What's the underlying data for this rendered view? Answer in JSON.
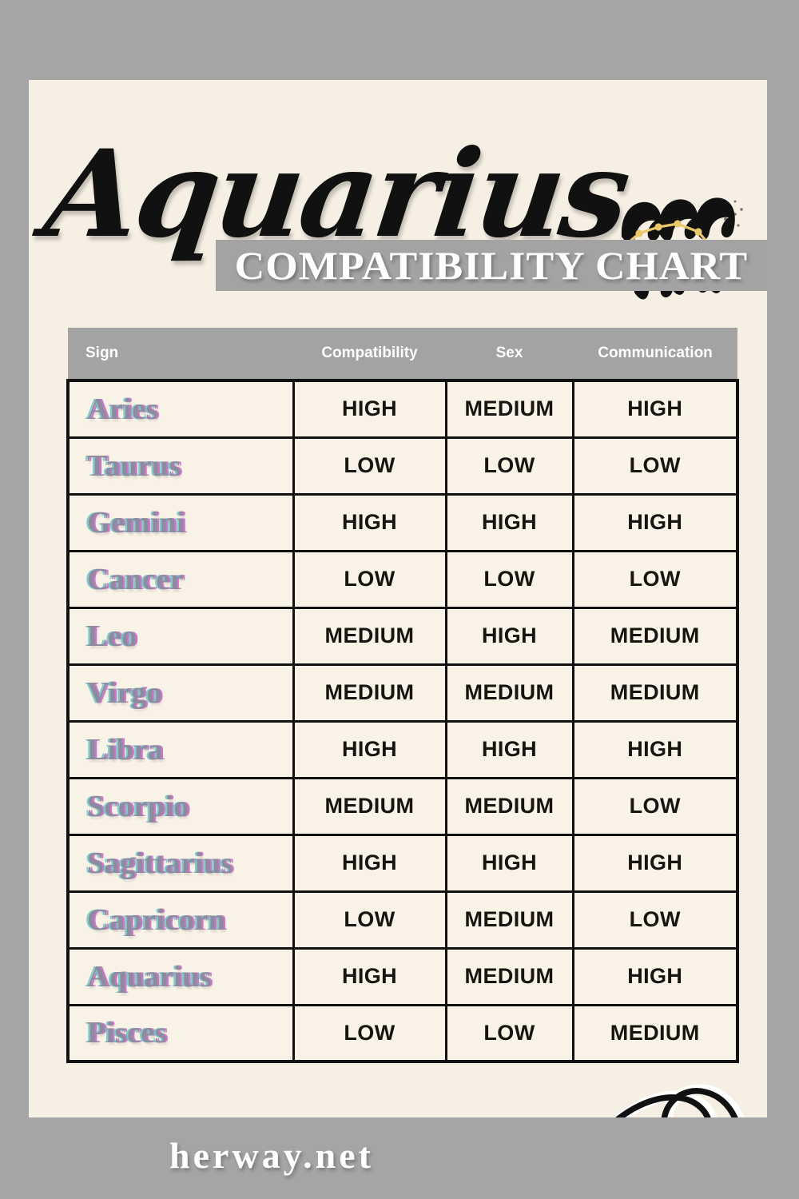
{
  "page": {
    "sign_title": "Aquarius",
    "banner_title": "COMPATIBILITY CHART",
    "site": "herway.net",
    "glyph_name": "aquarius-zodiac-glyph",
    "colors": {
      "outer_background": "#a5a5a5",
      "card_background": "#f6f0e4",
      "banner_gray": "#a3a3a3",
      "header_gray": "#a3a3a3",
      "cell_background": "#f8f2e7",
      "grid_line": "#111111",
      "sign_base": "#8e8ba0",
      "sign_cyan_fringe": "#6ec4c4",
      "sign_magenta_fringe": "#c45ac4",
      "value_text": "#17150f",
      "header_text": "#ffffff",
      "constellation_gold": "#e8c86a",
      "glyph_black": "#111111"
    }
  },
  "table": {
    "columns": [
      "Sign",
      "Compatibility",
      "Sex",
      "Communication"
    ],
    "rows": [
      {
        "sign": "Aries",
        "compatibility": "HIGH",
        "sex": "MEDIUM",
        "communication": "HIGH"
      },
      {
        "sign": "Taurus",
        "compatibility": "LOW",
        "sex": "LOW",
        "communication": "LOW"
      },
      {
        "sign": "Gemini",
        "compatibility": "HIGH",
        "sex": "HIGH",
        "communication": "HIGH"
      },
      {
        "sign": "Cancer",
        "compatibility": "LOW",
        "sex": "LOW",
        "communication": "LOW"
      },
      {
        "sign": "Leo",
        "compatibility": "MEDIUM",
        "sex": "HIGH",
        "communication": "MEDIUM"
      },
      {
        "sign": "Virgo",
        "compatibility": "MEDIUM",
        "sex": "MEDIUM",
        "communication": "MEDIUM"
      },
      {
        "sign": "Libra",
        "compatibility": "HIGH",
        "sex": "HIGH",
        "communication": "HIGH"
      },
      {
        "sign": "Scorpio",
        "compatibility": "MEDIUM",
        "sex": "MEDIUM",
        "communication": "LOW"
      },
      {
        "sign": "Sagittarius",
        "compatibility": "HIGH",
        "sex": "HIGH",
        "communication": "HIGH"
      },
      {
        "sign": "Capricorn",
        "compatibility": "LOW",
        "sex": "MEDIUM",
        "communication": "LOW"
      },
      {
        "sign": "Aquarius",
        "compatibility": "HIGH",
        "sex": "MEDIUM",
        "communication": "HIGH"
      },
      {
        "sign": "Pisces",
        "compatibility": "LOW",
        "sex": "LOW",
        "communication": "MEDIUM"
      }
    ]
  },
  "decorations": {
    "arrow_name": "curly-arrow-icon"
  }
}
